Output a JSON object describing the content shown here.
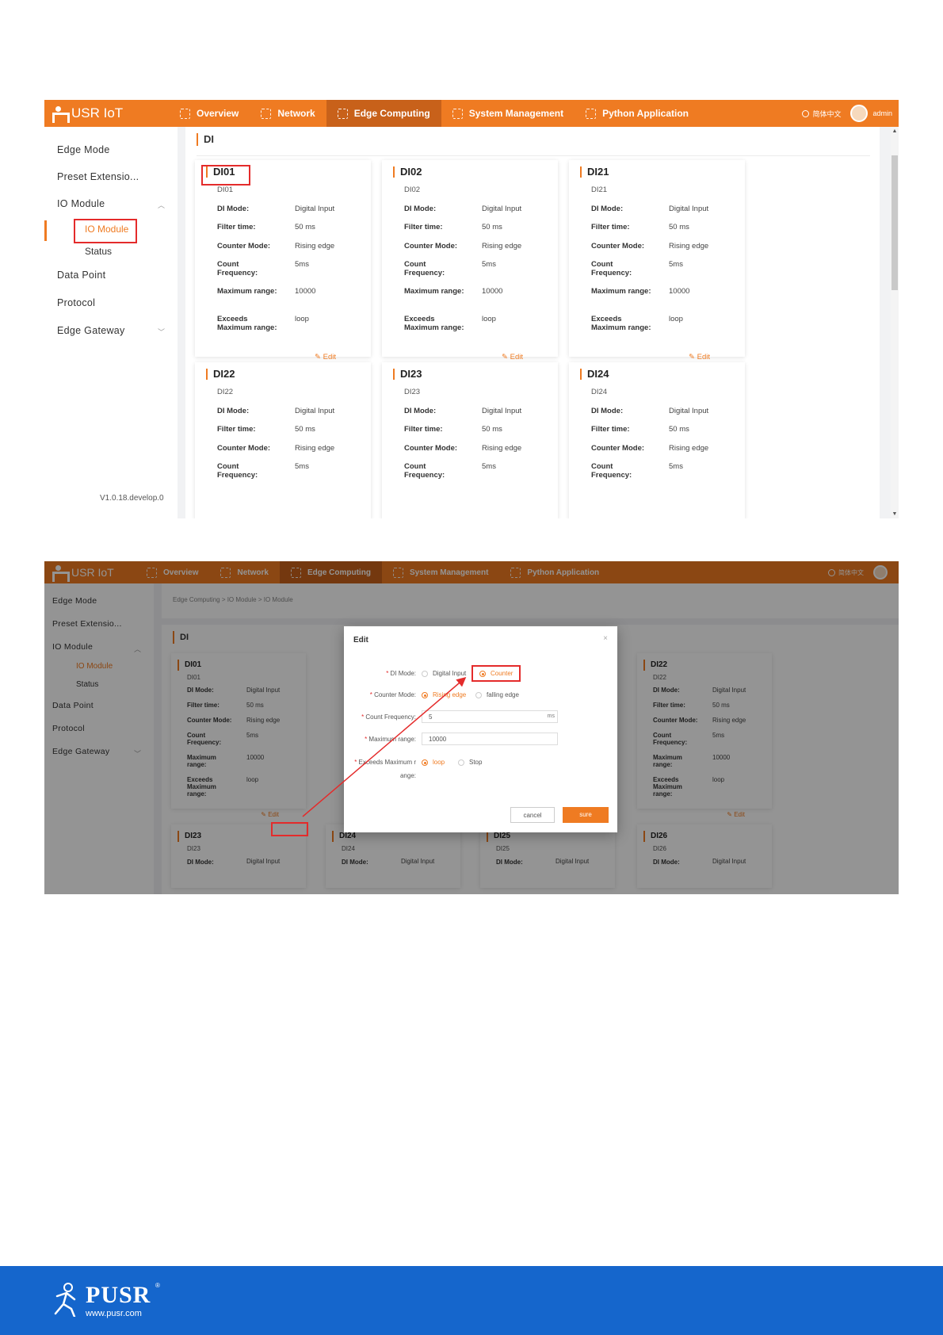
{
  "nav": {
    "brand": "USR IoT",
    "tabs": [
      "Overview",
      "Network",
      "Edge Computing",
      "System Management",
      "Python Application"
    ],
    "language": "简体中文",
    "user": "admin"
  },
  "sidebar": {
    "items": [
      "Edge Mode",
      "Preset Extensio...",
      "IO Module",
      "Data Point",
      "Protocol",
      "Edge Gateway"
    ],
    "io_sub": [
      "IO Module",
      "Status"
    ],
    "version": "V1.0.18.develop.0"
  },
  "section_title": "DI",
  "field_labels": {
    "mode": "DI Mode:",
    "filter": "Filter time:",
    "counter": "Counter Mode:",
    "freq": "Count Frequency:",
    "max": "Maximum range:",
    "exceeds": "Exceeds Maximum range:"
  },
  "edit_label": "Edit",
  "cards": [
    {
      "title": "DI01",
      "sub": "DI01",
      "mode": "Digital Input",
      "filter": "50 ms",
      "counter": "Rising edge",
      "freq": "5ms",
      "max": "10000",
      "exceeds": "loop"
    },
    {
      "title": "DI02",
      "sub": "DI02",
      "mode": "Digital Input",
      "filter": "50 ms",
      "counter": "Rising edge",
      "freq": "5ms",
      "max": "10000",
      "exceeds": "loop"
    },
    {
      "title": "DI21",
      "sub": "DI21",
      "mode": "Digital Input",
      "filter": "50 ms",
      "counter": "Rising edge",
      "freq": "5ms",
      "max": "10000",
      "exceeds": "loop"
    },
    {
      "title": "DI22",
      "sub": "DI22",
      "mode": "Digital Input",
      "filter": "50 ms",
      "counter": "Rising edge",
      "freq": "5ms"
    },
    {
      "title": "DI23",
      "sub": "DI23",
      "mode": "Digital Input",
      "filter": "50 ms",
      "counter": "Rising edge",
      "freq": "5ms"
    },
    {
      "title": "DI24",
      "sub": "DI24",
      "mode": "Digital Input",
      "filter": "50 ms",
      "counter": "Rising edge",
      "freq": "5ms"
    }
  ],
  "shot2": {
    "breadcrumb": "Edge Computing  >  IO Module  >  IO Module",
    "cards_top": [
      {
        "title": "DI01",
        "sub": "DI01",
        "mode": "Digital Input",
        "filter": "50 ms",
        "counter": "Rising edge",
        "freq": "5ms",
        "max": "10000",
        "exceeds": "loop"
      },
      {
        "title": "DI22",
        "sub": "DI22",
        "mode": "Digital Input",
        "filter": "50 ms",
        "counter": "Rising edge",
        "freq": "5ms",
        "max": "10000",
        "exceeds": "loop"
      }
    ],
    "cards_bottom": [
      {
        "title": "DI23",
        "sub": "DI23",
        "mode": "Digital Input"
      },
      {
        "title": "DI24",
        "sub": "DI24",
        "mode": "Digital Input"
      },
      {
        "title": "DI25",
        "sub": "DI25",
        "mode": "Digital Input"
      },
      {
        "title": "DI26",
        "sub": "DI26",
        "mode": "Digital Input"
      }
    ],
    "modal": {
      "title": "Edit",
      "di_mode_label": "DI Mode:",
      "di_mode_options": [
        "Digital Input",
        "Counter"
      ],
      "di_mode_selected": "Counter",
      "counter_mode_label": "Counter Mode:",
      "counter_mode_options": [
        "Rising edge",
        "falling edge"
      ],
      "counter_mode_selected": "Rising edge",
      "count_freq_label": "Count Frequency:",
      "count_freq_value": "5",
      "count_freq_unit": "ms",
      "max_range_label": "Maximum range:",
      "max_range_value": "10000",
      "exceeds_label_1": "Exceeds Maximum r",
      "exceeds_label_2": "ange:",
      "exceeds_options": [
        "loop",
        "Stop"
      ],
      "exceeds_selected": "loop",
      "cancel": "cancel",
      "sure": "sure"
    }
  },
  "footer": {
    "brand": "PUSR",
    "reg": "®",
    "url": "www.pusr.com"
  },
  "colors": {
    "accent": "#ef7b22",
    "nav_active": "#c8611a",
    "highlight": "#e42b2b",
    "footer": "#1566cc"
  }
}
